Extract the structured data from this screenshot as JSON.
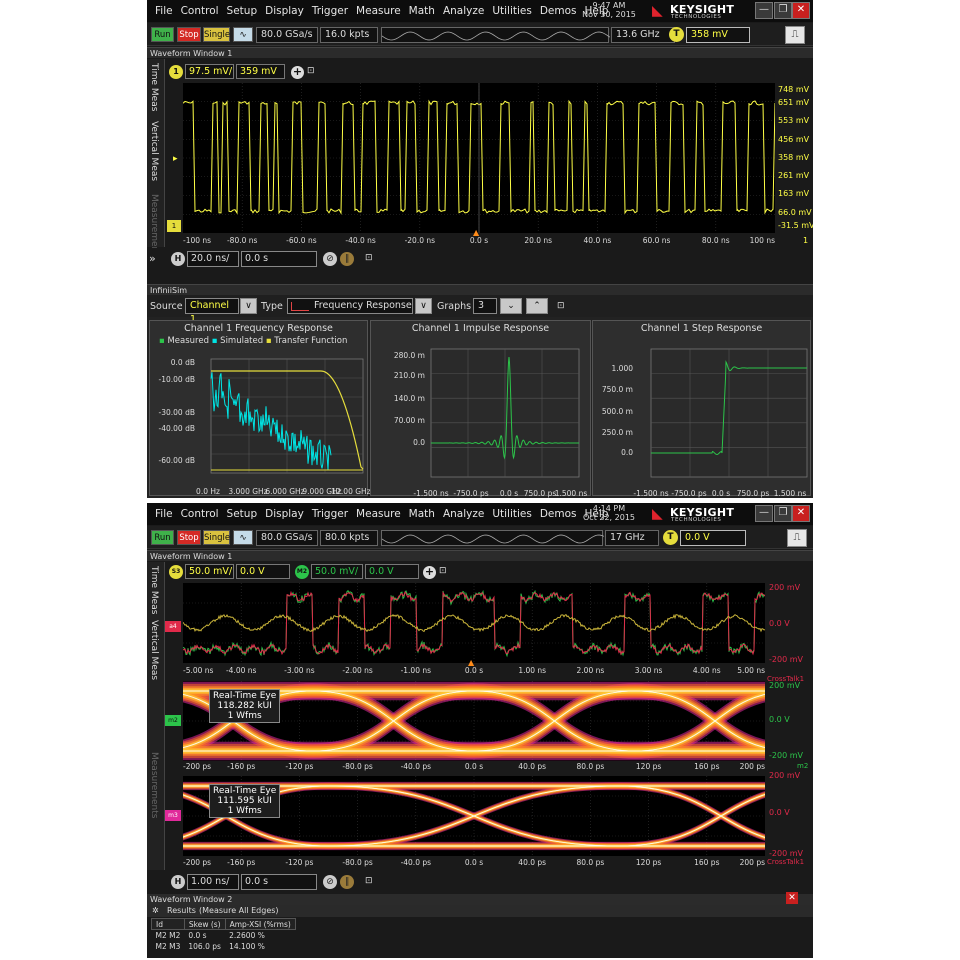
{
  "colors": {
    "accent_yellow": "#ffff46",
    "simulated": "#00e5e5",
    "transfer": "#e5dd3c",
    "impulse": "#2cc44a",
    "eye_orange": "#ff9a1f",
    "eye_magenta": "#e02a9a",
    "close_red": "#c8201f"
  },
  "menu": [
    "File",
    "Control",
    "Setup",
    "Display",
    "Trigger",
    "Measure",
    "Math",
    "Analyze",
    "Utilities",
    "Demos",
    "Help"
  ],
  "window_buttons": {
    "minimize": "—",
    "restore": "❐",
    "close": "✕"
  },
  "toolbar_labels": {
    "run": "Run",
    "stop": "Stop",
    "single": "Single"
  },
  "icons": {
    "auto_icon": "∿",
    "export_icon": "⎍",
    "pin_icon": "⊡",
    "plus_icon": "+"
  },
  "brand": {
    "name": "KEYSIGHT",
    "sub": "TECHNOLOGIES"
  },
  "scope1": {
    "time": "9:47 AM",
    "date": "Nov 30, 2015",
    "sample_rate": "80.0 GSa/s",
    "memory": "16.0 kpts",
    "bandwidth": "13.6 GHz",
    "trigger_badge": "T",
    "trigger_level": "358 mV",
    "window_title": "Waveform Window 1",
    "side_tabs": [
      "Time Meas",
      "Vertical Meas",
      "Measurements"
    ],
    "channel_badge": "1",
    "scale": "97.5 mV/",
    "offset": "359 mV",
    "y_ticks": [
      "748 mV",
      "651 mV",
      "553 mV",
      "456 mV",
      "358 mV",
      "261 mV",
      "163 mV",
      "66.0 mV",
      "-31.5 mV"
    ],
    "x_ticks": [
      "-100 ns",
      "-80.0 ns",
      "-60.0 ns",
      "-40.0 ns",
      "-20.0 ns",
      "0.0 s",
      "20.0 ns",
      "40.0 ns",
      "60.0 ns",
      "80.0 ns",
      "100 ns"
    ],
    "ch_end_label": "1",
    "timebase_badge": "H",
    "timebase": "20.0 ns/",
    "delay": "0.0 s",
    "expand": "»"
  },
  "infinisim": {
    "title": "InfiniiSim",
    "source_label": "Source",
    "source_value": "Channel 1",
    "type_label": "Type",
    "type_value": "Frequency Response",
    "graphs_label": "Graphs",
    "graphs_value": "3",
    "dropdown": "∨",
    "freq_panel": {
      "title": "Channel 1 Frequency Response",
      "legend": [
        "Measured",
        "Simulated",
        "Transfer Function"
      ],
      "y_ticks": [
        "0.0 dB",
        "-10.00 dB",
        "-30.00 dB",
        "-40.00 dB",
        "-60.00 dB"
      ],
      "x_ticks": [
        "0.0 Hz",
        "3.000 GHz",
        "6.000 GHz",
        "9.000 GHz",
        "12.00 GHz"
      ]
    },
    "impulse_panel": {
      "title": "Channel 1 Impulse Response",
      "y_ticks": [
        "280.0 m",
        "210.0 m",
        "140.0 m",
        "70.00 m",
        "0.0"
      ],
      "x_ticks": [
        "-1.500 ns",
        "-750.0 ps",
        "0.0 s",
        "750.0 ps",
        "1.500 ns"
      ]
    },
    "step_panel": {
      "title": "Channel 1 Step Response",
      "y_ticks": [
        "1.000",
        "750.0 m",
        "500.0 m",
        "250.0 m",
        "0.0"
      ],
      "x_ticks": [
        "-1.500 ns",
        "-750.0 ps",
        "0.0 s",
        "750.0 ps",
        "1.500 ns"
      ]
    }
  },
  "scope2": {
    "time": "4:14 PM",
    "date": "Oct 22, 2015",
    "sample_rate": "80.0 GSa/s",
    "memory": "80.0 kpts",
    "bandwidth": "17 GHz",
    "trigger_badge": "T",
    "trigger_level": "0.0 V",
    "window_title": "Waveform Window 1",
    "side_tabs": [
      "Time Meas",
      "Vertical Meas",
      "Measurements"
    ],
    "badge_a": "S3",
    "scale_a": "50.0 mV/",
    "offset_a": "0.0 V",
    "badge_b": "M2",
    "scale_b": "50.0 mV/",
    "offset_b": "0.0 V",
    "wave_y": [
      "200 mV",
      "0.0 V",
      "-200 mV"
    ],
    "wave_x": [
      "-5.00 ns",
      "-4.00 ns",
      "-3.00 ns",
      "-2.00 ns",
      "-1.00 ns",
      "0.0 s",
      "1.00 ns",
      "2.00 ns",
      "3.00 ns",
      "4.00 ns",
      "5.00 ns"
    ],
    "wave_end": "CrossTalk1",
    "eye1": {
      "label1": "Real-Time Eye",
      "label2": "118.282 kUI",
      "label3": "1 Wfms",
      "y": [
        "200 mV",
        "0.0 V",
        "-200 mV"
      ],
      "end": "m2"
    },
    "eye2": {
      "label1": "Real-Time Eye",
      "label2": "111.595 kUI",
      "label3": "1 Wfms",
      "y": [
        "200 mV",
        "0.0 V",
        "-200 mV"
      ],
      "end": "CrossTalk1"
    },
    "eye_x": [
      "-200 ps",
      "-160 ps",
      "-120 ps",
      "-80.0 ps",
      "-40.0 ps",
      "0.0 s",
      "40.0 ps",
      "80.0 ps",
      "120 ps",
      "160 ps",
      "200 ps"
    ],
    "timebase_badge": "H",
    "timebase": "1.00 ns/",
    "delay": "0.0 s",
    "window2_title": "Waveform Window 2",
    "results_label": "Results",
    "results_sub": "(Measure All Edges)",
    "table_headers": [
      "Id",
      "Skew (s)",
      "Amp-XSI (%rms)"
    ],
    "table_rows": [
      [
        "M2 M2",
        "0.0 s",
        "2.2600 %"
      ],
      [
        "M2 M3",
        "106.0 ps",
        "14.100 %"
      ]
    ]
  }
}
